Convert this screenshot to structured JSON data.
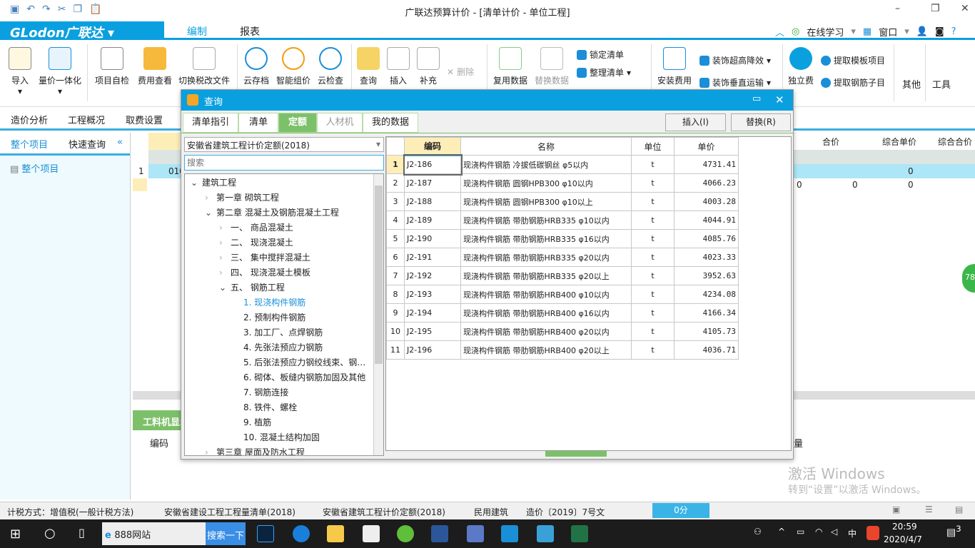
{
  "window": {
    "title": "广联达预算计价 - [清单计价 - 单位工程]"
  },
  "quick_access": [
    "save-icon",
    "undo-icon",
    "redo-icon",
    "cut-icon",
    "copy-icon",
    "paste-icon"
  ],
  "menu": {
    "brand": "GLodon广联达",
    "tabs": [
      "编制",
      "报表"
    ],
    "active_tab": "编制",
    "right": [
      "在线学习",
      "窗口"
    ]
  },
  "ribbon": {
    "buttons": [
      {
        "label": "导入"
      },
      {
        "label": "量价一体化"
      },
      {
        "label": "项目自检"
      },
      {
        "label": "费用查看"
      },
      {
        "label": "切换税改文件"
      },
      {
        "label": "云存档"
      },
      {
        "label": "智能组价"
      },
      {
        "label": "云检查"
      },
      {
        "label": "查询"
      },
      {
        "label": "插入"
      },
      {
        "label": "补充"
      },
      {
        "label": "删除"
      },
      {
        "label": "复用数据"
      },
      {
        "label": "替换数据"
      },
      {
        "label": "安装费用"
      },
      {
        "label": "独立费"
      },
      {
        "label": "其他"
      },
      {
        "label": "工具"
      }
    ],
    "small": [
      "锁定清单",
      "整理清单",
      "装饰超高降效",
      "装饰垂直运输",
      "提取模板项目",
      "提取钢筋子目"
    ]
  },
  "subtabs": [
    "造价分析",
    "工程概况",
    "取费设置"
  ],
  "left_panel": {
    "tabs": [
      "整个项目",
      "快速查询"
    ],
    "tree_root": "整个项目"
  },
  "main_grid": {
    "columns": [
      "合价",
      "综合单价",
      "综合合价"
    ],
    "row1_index": "1",
    "row1_code": "010",
    "values": {
      "r1_unit": "0",
      "r2_a": "0",
      "r2_b": "0",
      "r2_c": "0"
    }
  },
  "bottom": {
    "panel_title": "工料机显示",
    "col_code": "编码",
    "col_qty": "量"
  },
  "dialog": {
    "title": "查询",
    "tabs": [
      "清单指引",
      "清单",
      "定额",
      "人材机",
      "我的数据"
    ],
    "active_tab": "定额",
    "insert_label": "插入(I)",
    "replace_label": "替换(R)",
    "quota_select": "安徽省建筑工程计价定额(2018)",
    "search_placeholder": "搜索",
    "tree": [
      {
        "label": "建筑工程",
        "level": 0,
        "exp": "open"
      },
      {
        "label": "第一章  砌筑工程",
        "level": 1,
        "exp": "closed"
      },
      {
        "label": "第二章  混凝土及钢筋混凝土工程",
        "level": 1,
        "exp": "open"
      },
      {
        "label": "一、  商品混凝土",
        "level": 2,
        "exp": "closed"
      },
      {
        "label": "二、  现浇混凝土",
        "level": 2,
        "exp": "closed"
      },
      {
        "label": "三、  集中搅拌混凝土",
        "level": 2,
        "exp": "closed"
      },
      {
        "label": "四、  现浇混凝土模板",
        "level": 2,
        "exp": "closed"
      },
      {
        "label": "五、  钢筋工程",
        "level": 2,
        "exp": "open"
      },
      {
        "label": "1.  现浇构件钢筋",
        "level": 3,
        "exp": "",
        "selected": true
      },
      {
        "label": "2.  预制构件钢筋",
        "level": 3,
        "exp": ""
      },
      {
        "label": "3.  加工厂、点焊钢筋",
        "level": 3,
        "exp": ""
      },
      {
        "label": "4.  先张法预应力钢筋",
        "level": 3,
        "exp": ""
      },
      {
        "label": "5.  后张法预应力钢绞线束、钢…",
        "level": 3,
        "exp": ""
      },
      {
        "label": "6.  砌体、板缝内钢筋加固及其他",
        "level": 3,
        "exp": ""
      },
      {
        "label": "7.  钢筋连接",
        "level": 3,
        "exp": ""
      },
      {
        "label": "8.  铁件、螺栓",
        "level": 3,
        "exp": ""
      },
      {
        "label": "9.  植筋",
        "level": 3,
        "exp": ""
      },
      {
        "label": "10.  混凝土结构加固",
        "level": 3,
        "exp": ""
      },
      {
        "label": "第三章  屋面及防水工程",
        "level": 1,
        "exp": "closed"
      }
    ],
    "columns": [
      "编码",
      "名称",
      "单位",
      "单价"
    ],
    "rows": [
      [
        "1",
        "J2-186",
        "现浇构件钢筋 冷拔低碳钢丝 φ5以内",
        "t",
        "4731.41"
      ],
      [
        "2",
        "J2-187",
        "现浇构件钢筋 圆钢HPB300 φ10以内",
        "t",
        "4066.23"
      ],
      [
        "3",
        "J2-188",
        "现浇构件钢筋 圆钢HPB300 φ10以上",
        "t",
        "4003.28"
      ],
      [
        "4",
        "J2-189",
        "现浇构件钢筋 带肋钢筋HRB335 φ10以内",
        "t",
        "4044.91"
      ],
      [
        "5",
        "J2-190",
        "现浇构件钢筋 带肋钢筋HRB335 φ16以内",
        "t",
        "4085.76"
      ],
      [
        "6",
        "J2-191",
        "现浇构件钢筋 带肋钢筋HRB335 φ20以内",
        "t",
        "4023.33"
      ],
      [
        "7",
        "J2-192",
        "现浇构件钢筋 带肋钢筋HRB335 φ20以上",
        "t",
        "3952.63"
      ],
      [
        "8",
        "J2-193",
        "现浇构件钢筋 带肋钢筋HRB400 φ10以内",
        "t",
        "4234.08"
      ],
      [
        "9",
        "J2-194",
        "现浇构件钢筋 带肋钢筋HRB400 φ16以内",
        "t",
        "4166.34"
      ],
      [
        "10",
        "J2-195",
        "现浇构件钢筋 带肋钢筋HRB400 φ20以内",
        "t",
        "4105.73"
      ],
      [
        "11",
        "J2-196",
        "现浇构件钢筋 带肋钢筋HRB400 φ20以上",
        "t",
        "4036.71"
      ]
    ]
  },
  "watermark": {
    "line1": "激活 Windows",
    "line2": "转到“设置”以激活 Windows。"
  },
  "side_badge": "78",
  "status": {
    "tax": "计税方式：增值税(一般计税方法)",
    "list_std": "安徽省建设工程工程量清单(2018)",
    "quota_std": "安徽省建筑工程计价定额(2018)",
    "building": "民用建筑",
    "doc": "造价〔2019〕7号文",
    "score": "0分"
  },
  "taskbar": {
    "search_text": "888网站",
    "search_button": "搜索一下",
    "ime": "中",
    "time": "20:59",
    "date": "2020/4/7",
    "notifications": "3"
  },
  "colors": {
    "brand": "#0aa0e0",
    "active_tab": "#7dc06a",
    "selected_text": "#1a8fd8",
    "header_highlight": "#fdeeb8"
  }
}
